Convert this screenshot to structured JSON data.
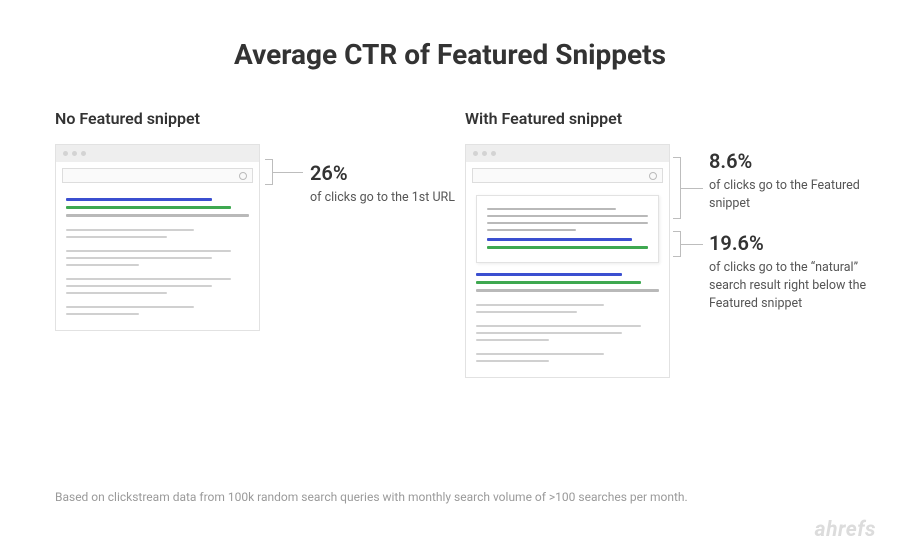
{
  "title": "Average CTR of Featured Snippets",
  "left": {
    "heading": "No Featured snippet",
    "callout1": {
      "pct": "26%",
      "desc": "of clicks go to the 1st URL"
    }
  },
  "right": {
    "heading": "With Featured snippet",
    "callout1": {
      "pct": "8.6%",
      "desc": "of clicks go to the Featured snippet"
    },
    "callout2": {
      "pct": "19.6%",
      "desc": "of clicks go to the “natural” search result right below the Featured snippet"
    }
  },
  "footnote": "Based on clickstream data from 100k random search queries with monthly search volume of >100 searches per month.",
  "brand": "ahrefs",
  "chart_data": {
    "type": "table",
    "title": "Average CTR of Featured Snippets",
    "series": [
      {
        "name": "No Featured snippet — 1st URL",
        "values": [
          26
        ]
      },
      {
        "name": "With Featured snippet — Featured snippet",
        "values": [
          8.6
        ]
      },
      {
        "name": "With Featured snippet — natural result below",
        "values": [
          19.6
        ]
      }
    ],
    "ylabel": "CTR (%)"
  }
}
